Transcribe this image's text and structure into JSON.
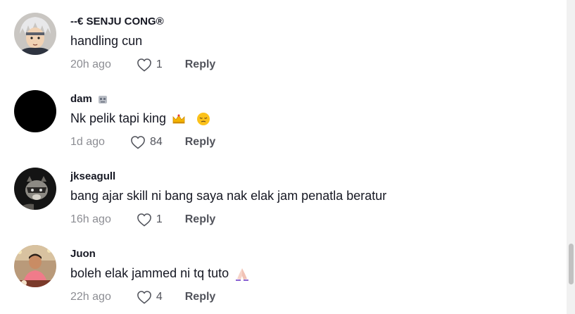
{
  "comments": [
    {
      "username": "--€ SENJU CONG®",
      "text": "handling cun",
      "time": "20h ago",
      "likes": "1",
      "reply_label": "Reply",
      "avatar_icon": "anime-character-avatar"
    },
    {
      "username": "dam",
      "username_icon": "robot-icon",
      "text": "Nk pelik tapi king",
      "text_emojis": [
        "crown-emoji",
        "pensive-face-emoji"
      ],
      "time": "1d ago",
      "likes": "84",
      "reply_label": "Reply",
      "avatar_icon": "black-avatar"
    },
    {
      "username": "jkseagull",
      "text": "bang ajar skill ni bang saya nak elak jam penatla beratur",
      "time": "16h ago",
      "likes": "1",
      "reply_label": "Reply",
      "avatar_icon": "raccoon-avatar"
    },
    {
      "username": "Juon",
      "text": "boleh elak jammed ni tq tuto",
      "text_emojis": [
        "folded-hands-emoji"
      ],
      "time": "22h ago",
      "likes": "4",
      "reply_label": "Reply",
      "avatar_icon": "person-photo-avatar"
    }
  ],
  "colors": {
    "text_primary": "#161823",
    "text_secondary": "rgba(22,24,35,0.5)",
    "background": "#ffffff"
  }
}
